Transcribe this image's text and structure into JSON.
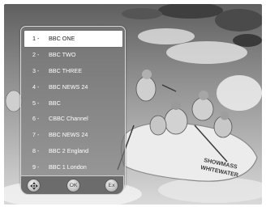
{
  "channel_list": {
    "items": [
      {
        "num": "1 -",
        "name": "BBC ONE",
        "selected": true
      },
      {
        "num": "2 -",
        "name": "BBC TWO",
        "selected": false
      },
      {
        "num": "3 -",
        "name": "BBC THREE",
        "selected": false
      },
      {
        "num": "4 -",
        "name": "BBC NEWS 24",
        "selected": false
      },
      {
        "num": "5 -",
        "name": "BBC",
        "selected": false
      },
      {
        "num": "6 -",
        "name": "CBBC Channel",
        "selected": false
      },
      {
        "num": "7 -",
        "name": "BBC NEWS 24",
        "selected": false
      },
      {
        "num": "8 -",
        "name": "BBC 2 England",
        "selected": false
      },
      {
        "num": "9 -",
        "name": "BBC 1 London",
        "selected": false
      }
    ]
  },
  "footer": {
    "nav_icon": "four-way-arrow-icon",
    "ok_label": "OK",
    "exit_label": "Ex"
  },
  "background": {
    "raft_text_line1": "SHOWMASS",
    "raft_text_line2": "WHITEWATER"
  }
}
